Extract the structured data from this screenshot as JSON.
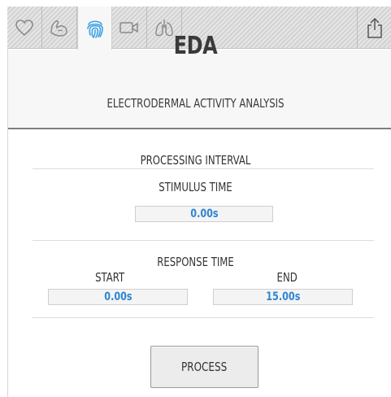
{
  "tabs": [
    {
      "icon": "heart-icon",
      "active": false
    },
    {
      "icon": "muscle-icon",
      "active": false
    },
    {
      "icon": "fingerprint-icon",
      "active": true
    },
    {
      "icon": "video-camera-icon",
      "active": false
    },
    {
      "icon": "lungs-icon",
      "active": false
    }
  ],
  "share": {
    "icon": "share-icon"
  },
  "header": {
    "title": "EDA",
    "subtitle": "ELECTRODERMAL ACTIVITY ANALYSIS"
  },
  "processing": {
    "heading": "PROCESSING INTERVAL",
    "stimulus_label": "STIMULUS TIME",
    "stimulus_value": "0.00s"
  },
  "response": {
    "heading": "RESPONSE TIME",
    "start_label": "START",
    "start_value": "0.00s",
    "end_label": "END",
    "end_value": "15.00s"
  },
  "actions": {
    "process_label": "PROCESS"
  },
  "colors": {
    "accent_value": "#2f86d2",
    "active_tab": "#3aa0e6",
    "inactive_icon": "#8a8a8a"
  }
}
